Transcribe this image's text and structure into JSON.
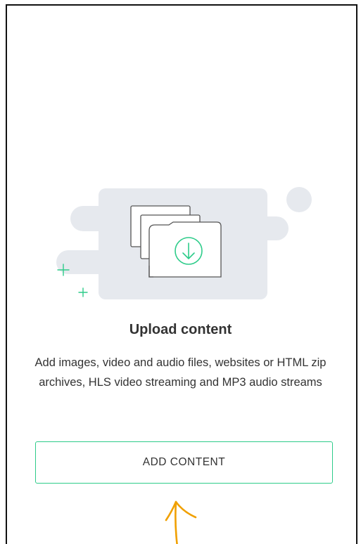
{
  "upload_panel": {
    "title": "Upload content",
    "description": "Add images, video and audio files, websites or HTML zip archives, HLS video streaming and MP3 audio streams",
    "add_button_label": "ADD CONTENT"
  },
  "icons": {
    "illustration": "stacked-files-download-icon",
    "download": "download-arrow-circle-icon",
    "sparkle": "plus-sparkle-icon",
    "annotation": "handdrawn-arrow-up-icon"
  },
  "colors": {
    "accent": "#2ecc8a",
    "blob": "#e6e9ee",
    "text": "#333333",
    "annotation": "#f0a000",
    "frame_border": "#111111"
  }
}
